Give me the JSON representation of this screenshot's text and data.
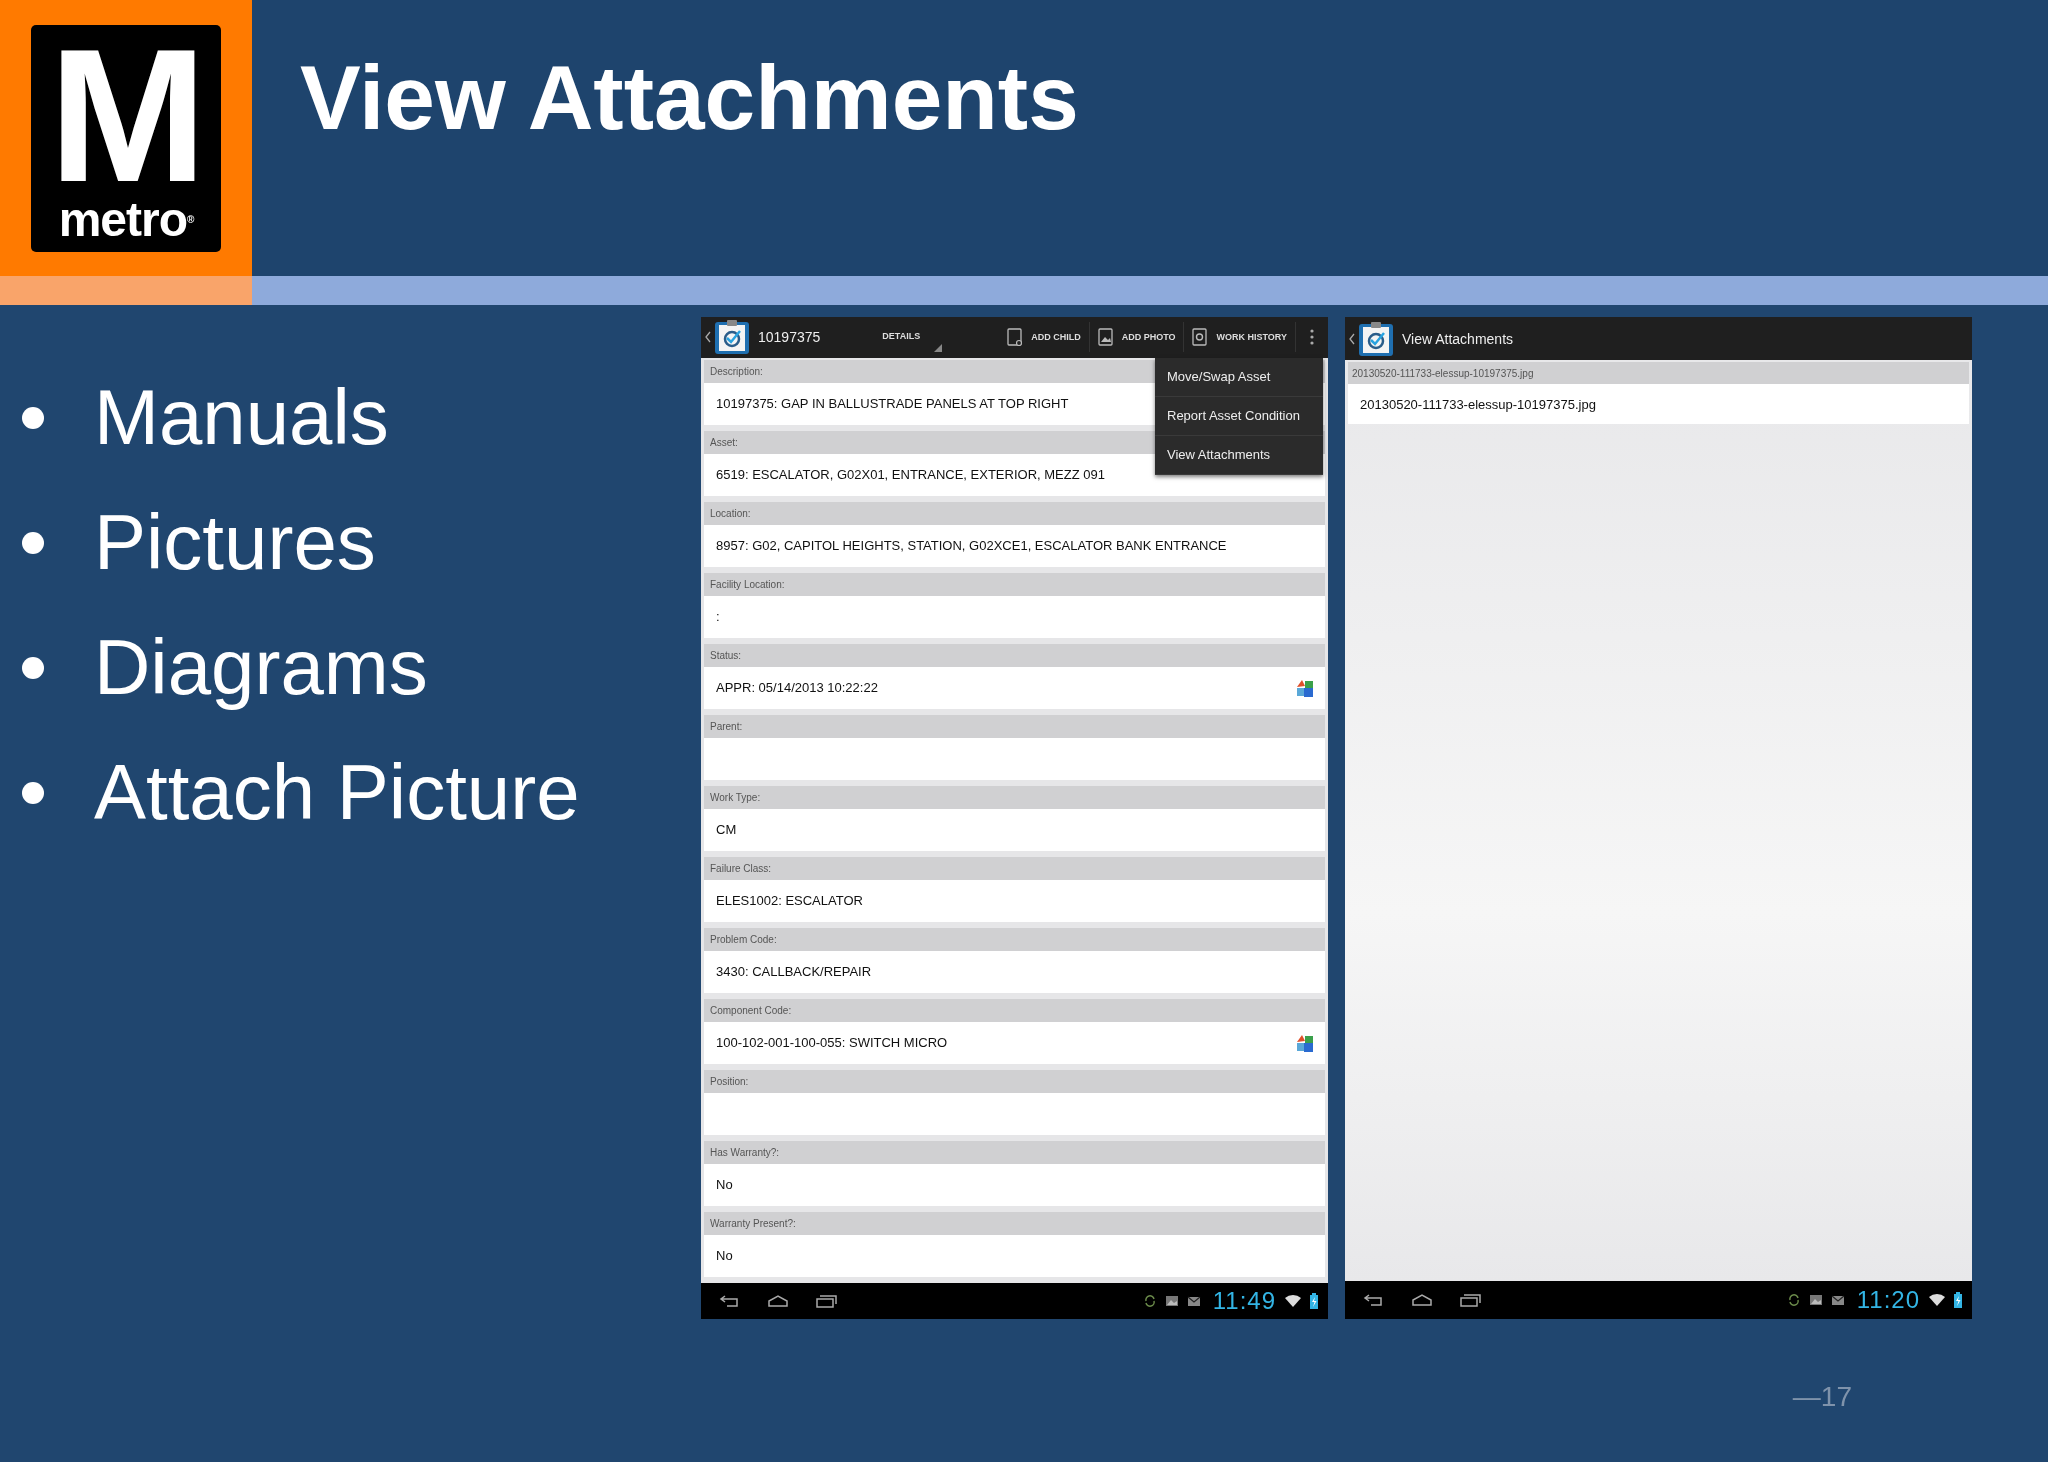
{
  "logo": {
    "letter": "M",
    "word": "metro",
    "mark": "®"
  },
  "title": "View Attachments",
  "bullets": [
    "Manuals",
    "Pictures",
    "Diagrams",
    "Attach Picture"
  ],
  "screens": [
    {
      "kind": "details",
      "title": "10197375",
      "spinner": "DETAILS",
      "actions": [
        {
          "label": "ADD CHILD",
          "kind": "child"
        },
        {
          "label": "ADD PHOTO",
          "kind": "photo"
        },
        {
          "label": "WORK HISTORY",
          "kind": "history"
        }
      ],
      "fields": [
        {
          "label": "Description:",
          "value": "10197375: GAP IN BALLUSTRADE PANELS AT TOP RIGHT"
        },
        {
          "label": "Asset:",
          "value": "6519: ESCALATOR, G02X01, ENTRANCE, EXTERIOR, MEZZ 091",
          "lookup": false
        },
        {
          "label": "Location:",
          "value": "8957: G02, CAPITOL HEIGHTS, STATION, G02XCE1, ESCALATOR BANK ENTRANCE",
          "lookup": false
        },
        {
          "label": "Facility Location:",
          "value": ":",
          "lookup": false
        },
        {
          "label": "Status:",
          "value": "APPR: 05/14/2013 10:22:22",
          "lookup": true
        },
        {
          "label": "Parent:",
          "lookup": false
        },
        {
          "label": "Work Type:",
          "value": "CM",
          "lookup": false
        },
        {
          "label": "Failure Class:",
          "value": "ELES1002: ESCALATOR",
          "lookup": false
        },
        {
          "label": "Problem Code:",
          "value": "3430: CALLBACK/REPAIR",
          "lookup": false
        },
        {
          "label": "Component Code:",
          "value": "100-102-001-100-055: SWITCH MICRO",
          "lookup": true
        },
        {
          "label": "Position:",
          "lookup": false
        },
        {
          "label": "Has Warranty?:",
          "value": "No",
          "lookup": false
        },
        {
          "label": "Warranty Present?:",
          "value": "No",
          "lookup": false
        }
      ],
      "menu": [
        "Move/Swap Asset",
        "Report Asset Condition",
        "View Attachments"
      ],
      "time": "11:49"
    },
    {
      "kind": "attachments",
      "title": "View Attachments",
      "header": "20130520-111733-elessup-10197375.jpg",
      "items": [
        "20130520-111733-elessup-10197375.jpg"
      ],
      "time": "11:20"
    }
  ],
  "page_number": "—17"
}
